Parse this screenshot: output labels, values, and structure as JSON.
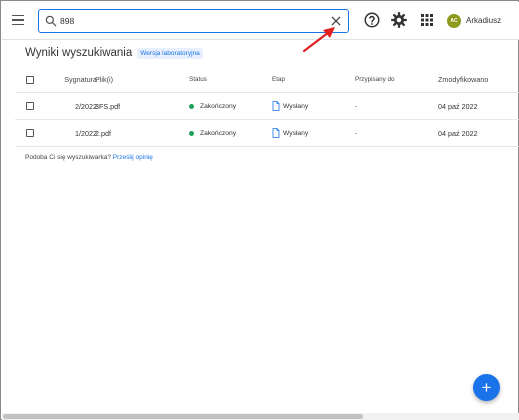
{
  "search": {
    "value": "898",
    "placeholder": ""
  },
  "header": {
    "user": {
      "initials": "AC",
      "name": "Arkadiusz",
      "avatar_color": "#8e9a1e"
    }
  },
  "main": {
    "title": "Wyniki wyszukiwania",
    "badge": "Wersja laboratoryjna",
    "table": {
      "columns": [
        "Sygnatura",
        "Plik(i)",
        "Status",
        "Etap",
        "Przypisany do",
        "Zmodyfikowano"
      ],
      "rows": [
        {
          "signature": "2/2022",
          "file": "3FS.pdf",
          "status": "Zakończony",
          "stage": "Wysłany",
          "assigned": "-",
          "modified": "04 paź 2022"
        },
        {
          "signature": "1/2022",
          "file": "2.pdf",
          "status": "Zakończony",
          "stage": "Wysłany",
          "assigned": "-",
          "modified": "04 paź 2022"
        }
      ]
    },
    "feedback": {
      "text": "Podoba Ci się wyszukiwarka?",
      "link": "Prześlij opinię"
    }
  },
  "fab": {
    "label": "+"
  },
  "colors": {
    "accent": "#1a73e8",
    "status_done": "#1e9e5a",
    "annotation_arrow": "#e02020"
  },
  "icons": [
    "menu-icon",
    "search-icon",
    "close-icon",
    "help-icon",
    "gear-icon",
    "apps-grid-icon",
    "document-icon",
    "plus-icon"
  ]
}
